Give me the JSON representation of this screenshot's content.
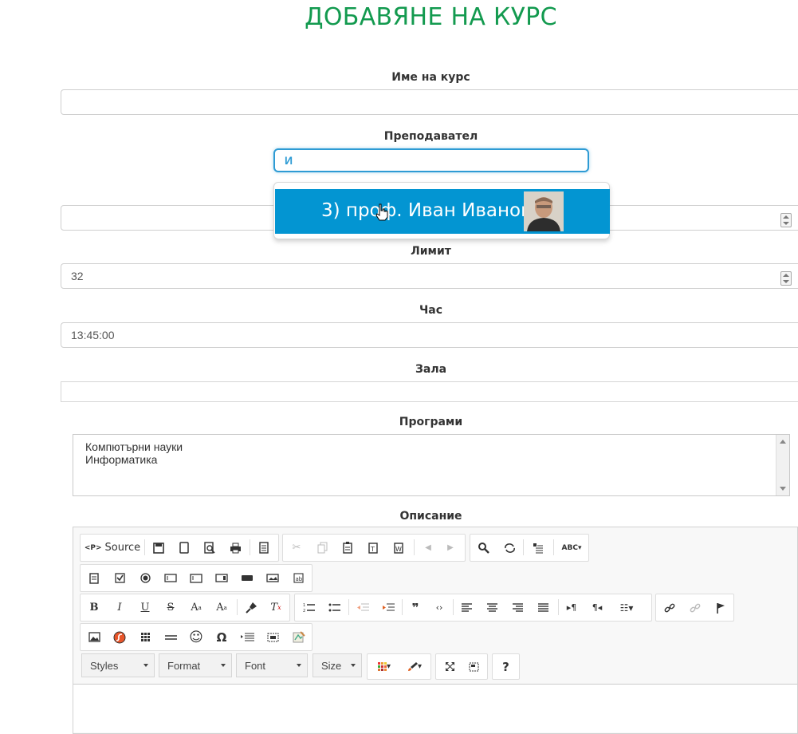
{
  "page": {
    "title": "ДОБАВЯНЕ НА КУРС"
  },
  "fields": {
    "course_name": {
      "label": "Име на курс",
      "value": ""
    },
    "teacher": {
      "label": "Преподавател",
      "typed": "И",
      "suggestion": "3) проф. Иван Иванов"
    },
    "hidden_number": {
      "value": ""
    },
    "limit": {
      "label": "Лимит",
      "value": "32"
    },
    "hour": {
      "label": "Час",
      "value": "13:45:00"
    },
    "room": {
      "label": "Зала",
      "value": ""
    },
    "programs": {
      "label": "Програми",
      "items": [
        "Компютърни науки",
        "Информатика"
      ]
    },
    "description": {
      "label": "Описание"
    }
  },
  "editor": {
    "source_label": "Source",
    "source_tag": "<P>",
    "combos": {
      "styles": "Styles",
      "format": "Format",
      "font": "Font",
      "size": "Size"
    },
    "help_label": "?"
  },
  "colors": {
    "title": "#139a4f",
    "accent": "#0395d2",
    "focus": "#2e9bd4"
  }
}
